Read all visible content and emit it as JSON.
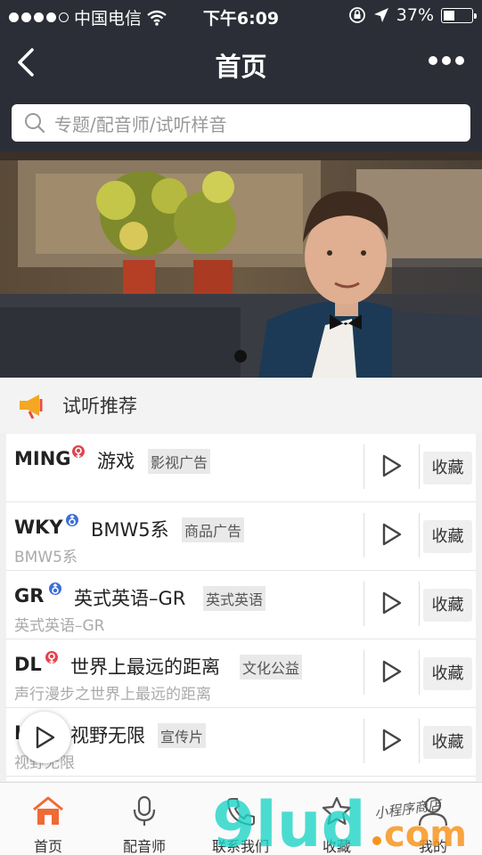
{
  "status_bar": {
    "carrier": "中国电信",
    "time": "下午6:09",
    "battery": "37%",
    "battery_level": 0.37
  },
  "nav": {
    "title": "首页",
    "back_icon": "chevron-left-icon",
    "more_icon": "more-dots-icon"
  },
  "search": {
    "placeholder": "专题/配音师/试听样音"
  },
  "section": {
    "title": "试听推荐",
    "icon": "megaphone-icon",
    "accent": "#f5a623"
  },
  "list": [
    {
      "name": "MING",
      "gender": "female",
      "title": "游戏",
      "tag": "影视广告",
      "subtitle": "",
      "fav": "收藏"
    },
    {
      "name": "WKY",
      "gender": "male",
      "title": "BMW5系",
      "tag": "商品广告",
      "subtitle": "BMW5系",
      "fav": "收藏"
    },
    {
      "name": "GR",
      "gender": "male",
      "title": "英式英语–GR",
      "tag": "英式英语",
      "subtitle": "英式英语–GR",
      "fav": "收藏"
    },
    {
      "name": "DL",
      "gender": "female",
      "title": "世界上最远的距离",
      "tag": "文化公益",
      "subtitle": "声行漫步之世界上最远的距离",
      "fav": "收藏"
    },
    {
      "name": "L",
      "gender": "",
      "title": "视野无限",
      "tag": "宣传片",
      "subtitle": "视野无限",
      "fav": "收藏"
    }
  ],
  "tabbar": [
    {
      "label": "首页",
      "icon": "home-icon",
      "active": true
    },
    {
      "label": "配音师",
      "icon": "microphone-icon",
      "active": false
    },
    {
      "label": "联系我们",
      "icon": "phone-icon",
      "active": false
    },
    {
      "label": "收藏",
      "icon": "star-icon",
      "active": false
    },
    {
      "label": "我的",
      "icon": "user-icon",
      "active": false
    }
  ],
  "watermark": {
    "text": "9lud.com",
    "small_text": "小程序商店"
  },
  "colors": {
    "header_bg": "#2b2e36",
    "female": "#e0454f",
    "male": "#3e6fd8",
    "active_tab": "#f06a35",
    "watermark": "#19d3c5",
    "watermark_dot": "#f7941d"
  }
}
